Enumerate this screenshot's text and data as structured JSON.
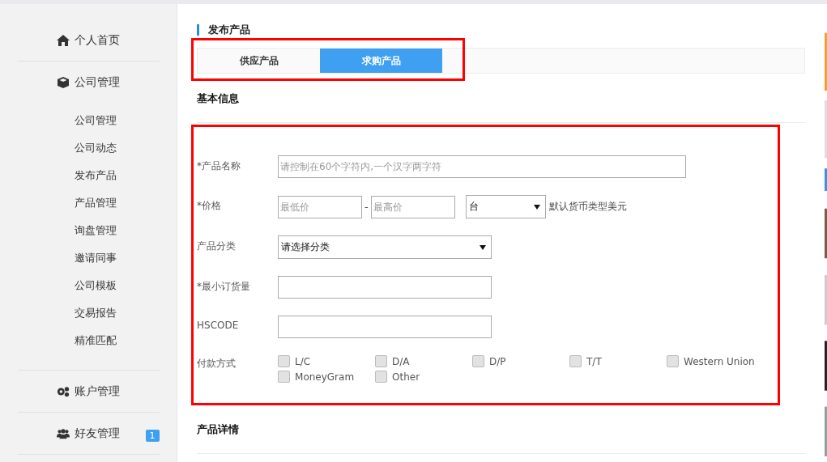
{
  "sidebar": {
    "sections": [
      {
        "label": "个人首页"
      },
      {
        "label": "公司管理",
        "children": [
          {
            "label": "公司管理"
          },
          {
            "label": "公司动态"
          },
          {
            "label": "发布产品"
          },
          {
            "label": "产品管理"
          },
          {
            "label": "询盘管理"
          },
          {
            "label": "邀请同事"
          },
          {
            "label": "公司模板"
          },
          {
            "label": "交易报告"
          },
          {
            "label": "精准匹配"
          }
        ]
      },
      {
        "label": "账户管理"
      },
      {
        "label": "好友管理",
        "badge": "1"
      }
    ]
  },
  "page_title": "发布产品",
  "tabs": {
    "highlighted": true,
    "items": [
      {
        "label": "供应产品",
        "selected": false
      },
      {
        "label": "求购产品",
        "selected": true
      }
    ]
  },
  "basic_info": {
    "heading": "基本信息",
    "highlighted": true,
    "fields": [
      {
        "kind": "text",
        "label": "*产品名称",
        "placeholder": "请控制在60个字符内,一个汉字两字符"
      },
      {
        "kind": "price",
        "label": "*价格",
        "min_placeholder": "最低价",
        "separator": "-",
        "max_placeholder": "最高价",
        "unit": "台",
        "note": "默认货币类型美元"
      },
      {
        "kind": "select",
        "label": "产品分类",
        "value": "请选择分类"
      },
      {
        "kind": "short",
        "label": "*最小订货量"
      },
      {
        "kind": "short",
        "label": "HSCODE"
      },
      {
        "kind": "checks",
        "label": "付款方式",
        "options": [
          {
            "label": "L/C",
            "checked": false
          },
          {
            "label": "D/A",
            "checked": false
          },
          {
            "label": "D/P",
            "checked": false
          },
          {
            "label": "T/T",
            "checked": false
          },
          {
            "label": "Western Union",
            "checked": false
          },
          {
            "label": "MoneyGram",
            "checked": false
          },
          {
            "label": "Other",
            "checked": false
          }
        ]
      }
    ]
  },
  "details": {
    "heading": "产品详情"
  }
}
